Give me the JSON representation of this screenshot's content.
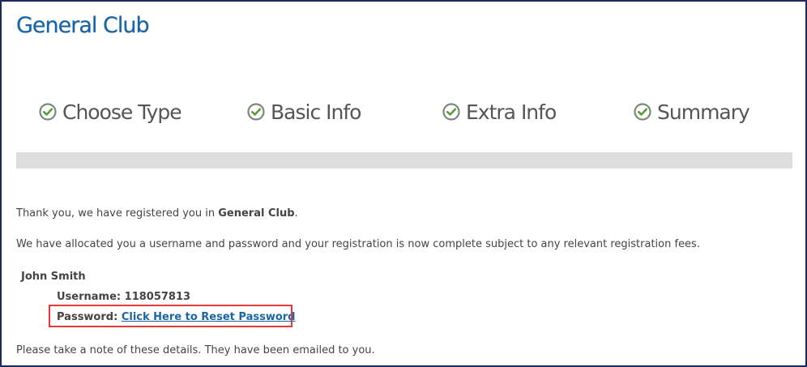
{
  "header": {
    "title": "General Club"
  },
  "steps": [
    {
      "label": "Choose Type",
      "icon": "check-circle-icon",
      "status": "complete"
    },
    {
      "label": "Basic Info",
      "icon": "check-circle-icon",
      "status": "complete"
    },
    {
      "label": "Extra Info",
      "icon": "check-circle-icon",
      "status": "complete"
    },
    {
      "label": "Summary",
      "icon": "check-circle-icon",
      "status": "complete"
    }
  ],
  "colors": {
    "title": "#1a66a5",
    "link": "#1a66a5",
    "step_icon": "#7a8a7a",
    "progress_track": "#dddddd",
    "highlight": "#e03a3a",
    "frame_border": "#1c2a5e"
  },
  "confirmation": {
    "thanks_prefix": "Thank you, we have registered you in ",
    "club_name": "General Club",
    "thanks_suffix": ".",
    "allocation_text": "We have allocated you a username and password and your registration is now complete subject to any relevant registration fees.",
    "member_name": "John Smith",
    "username_label": "Username:",
    "username_value": "118057813",
    "password_label": "Password:",
    "reset_link_text": "Click Here to Reset Password",
    "note_text": "Please take a note of these details. They have been emailed to you."
  }
}
